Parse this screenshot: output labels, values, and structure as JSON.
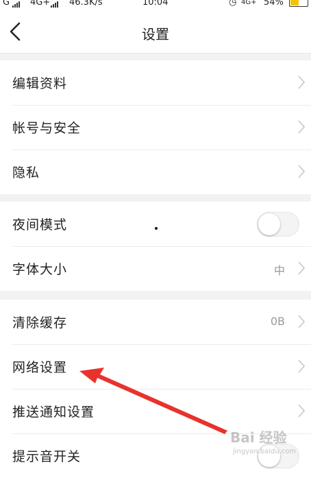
{
  "status_bar": {
    "carrier_left": "G",
    "network": "4G+",
    "speed": "46.3K/s",
    "time": "10:04",
    "network_right": "4G+",
    "battery": "54%",
    "battery_level": 0.54
  },
  "header": {
    "title": "设置",
    "back_icon": "chevron-left-icon"
  },
  "groups": [
    {
      "items": [
        {
          "label": "编辑资料",
          "value": "",
          "control": "chevron"
        },
        {
          "label": "帐号与安全",
          "value": "",
          "control": "chevron"
        },
        {
          "label": "隐私",
          "value": "",
          "control": "chevron"
        }
      ]
    },
    {
      "items": [
        {
          "label": "夜间模式",
          "value": "",
          "control": "toggle",
          "toggle_on": false
        },
        {
          "label": "字体大小",
          "value": "中",
          "control": "chevron"
        }
      ]
    },
    {
      "items": [
        {
          "label": "清除缓存",
          "value": "0B",
          "control": "chevron"
        },
        {
          "label": "网络设置",
          "value": "",
          "control": "chevron"
        },
        {
          "label": "推送通知设置",
          "value": "",
          "control": "chevron"
        },
        {
          "label": "提示音开关",
          "value": "",
          "control": "toggle"
        }
      ]
    }
  ],
  "annotation": {
    "arrow_color": "#e8322d"
  },
  "watermark": {
    "brand": "Bai 经验",
    "url": "jingyan.baidu.com"
  },
  "colors": {
    "background": "#f2f2f2",
    "separator": "#ececec",
    "chevron": "#c7c7c7"
  }
}
